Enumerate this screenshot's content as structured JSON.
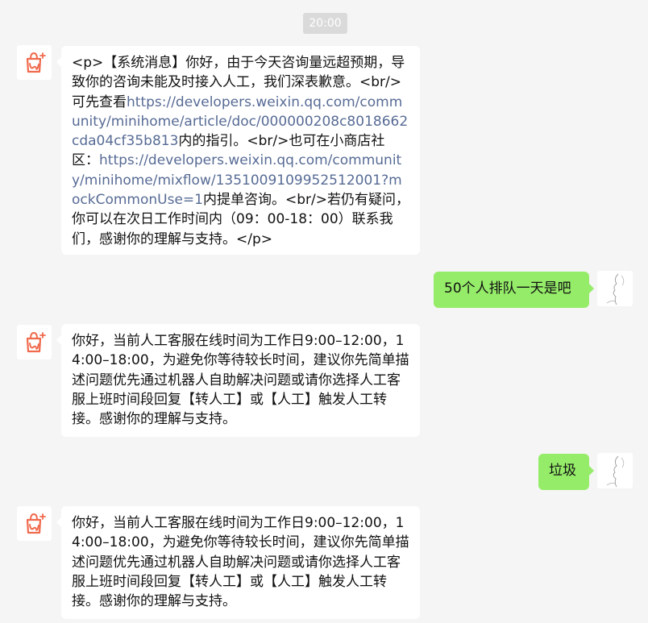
{
  "timestamp": "20:00",
  "messages": [
    {
      "sender": "bot",
      "parts": [
        {
          "text": "<p>【系统消息】你好，由于今天咨询量远超预期，导致你的咨询未能及时接入人工，我们深表歉意。<br/>可先查看"
        },
        {
          "link": "https://developers.weixin.qq.com/community/minihome/article/doc/000000208c8018662cda04cf35b813"
        },
        {
          "text": "内的指引。<br/>也可在小商店社区："
        },
        {
          "link": "https://developers.weixin.qq.com/community/minihome/mixflow/1351009109952512001?mockCommonUse=1"
        },
        {
          "text": "内提单咨询。<br/>若仍有疑问，你可以在次日工作时间内（09：00-18：00）联系我们，感谢你的理解与支持。</p>"
        }
      ]
    },
    {
      "sender": "user",
      "text": "50个人排队一天是吧"
    },
    {
      "sender": "bot",
      "text": "你好，当前人工客服在线时间为工作日9:00–12:00，14:00–18:00，为避免你等待较长时间，建议你先简单描述问题优先通过机器人自助解决问题或请你选择人工客服上班时间段回复【转人工】或【人工】触发人工转接。感谢你的理解与支持。"
    },
    {
      "sender": "user",
      "text": "垃圾"
    },
    {
      "sender": "bot",
      "text": "你好，当前人工客服在线时间为工作日9:00–12:00，14:00–18:00，为避免你等待较长时间，建议你先简单描述问题优先通过机器人自助解决问题或请你选择人工客服上班时间段回复【转人工】或【人工】触发人工转接。感谢你的理解与支持。"
    }
  ],
  "colors": {
    "background": "#f5f5f5",
    "bot_bubble": "#ffffff",
    "user_bubble": "#95ec69",
    "link": "#576b95",
    "brand_icon": "#f06a4e"
  },
  "icons": {
    "bot_avatar": "shop-bag-logo-icon",
    "user_avatar": "line-sketch-avatar"
  }
}
